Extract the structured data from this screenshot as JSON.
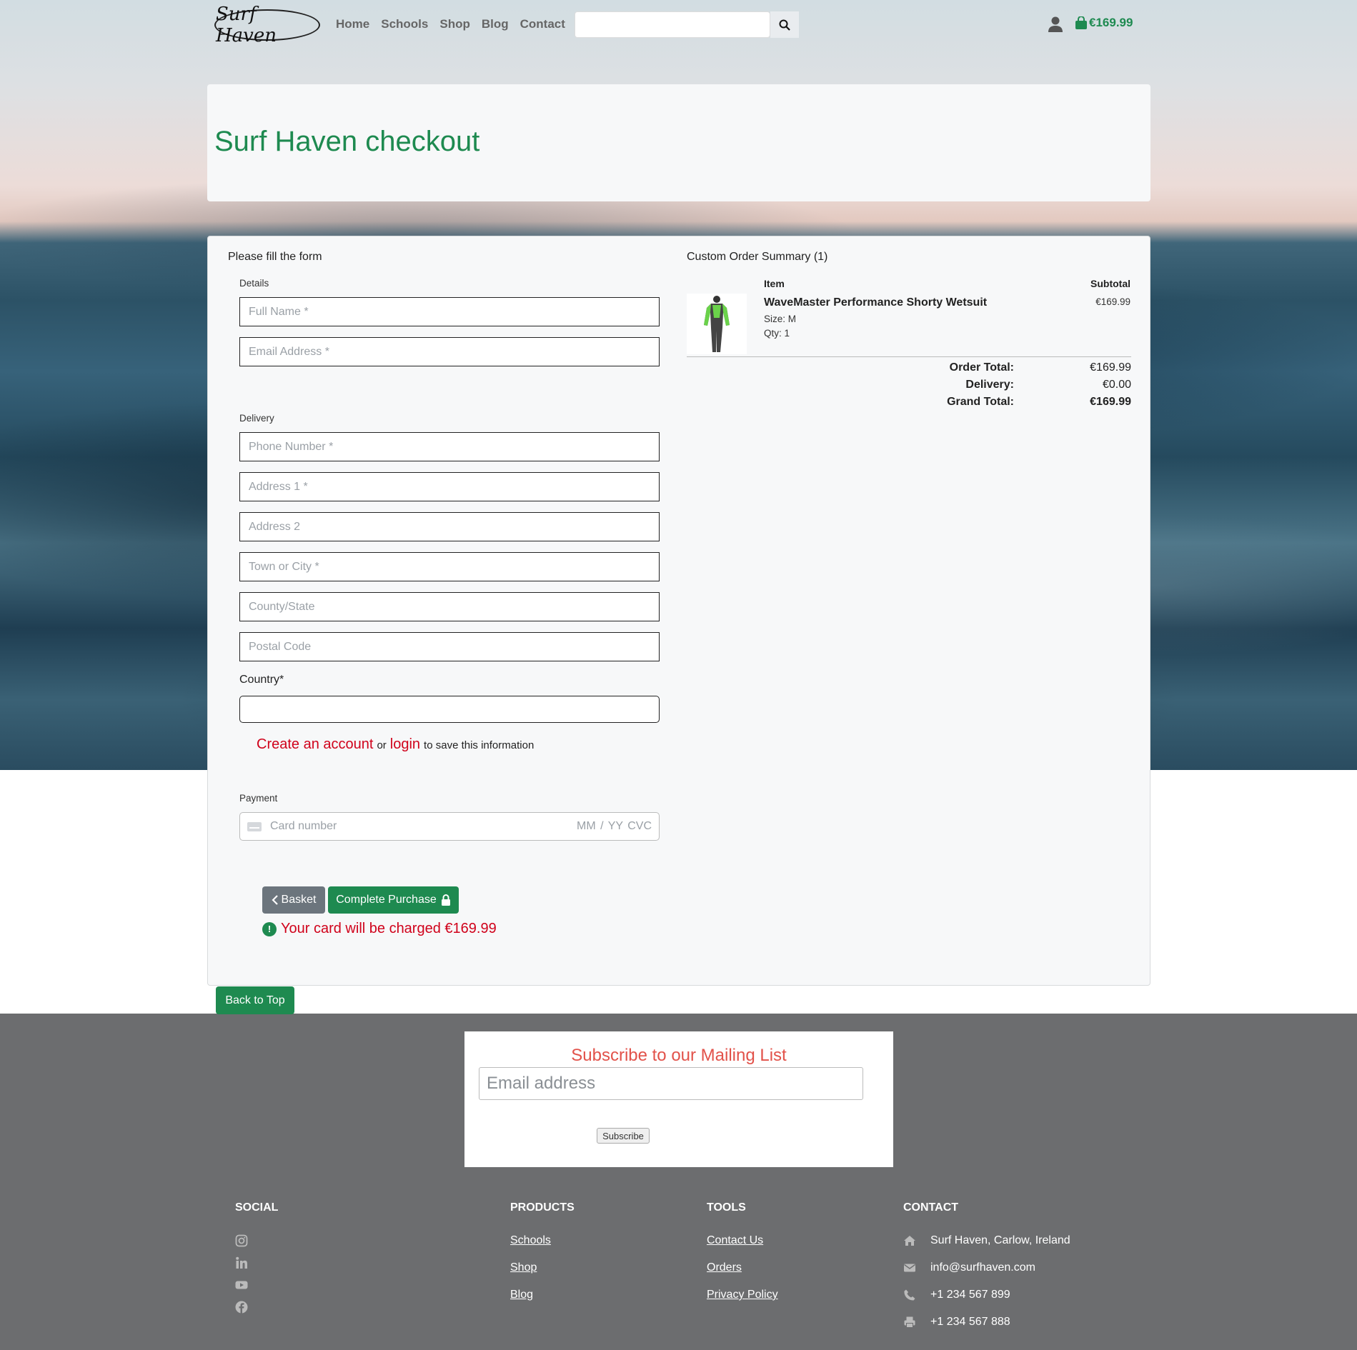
{
  "nav": {
    "logo_text": "Surf Haven",
    "links": [
      "Home",
      "Schools",
      "Shop",
      "Blog",
      "Contact"
    ],
    "cart_total": "€169.99"
  },
  "header": {
    "title": "Surf Haven checkout"
  },
  "form": {
    "heading": "Please fill the form",
    "details_label": "Details",
    "full_name_placeholder": "Full Name *",
    "email_placeholder": "Email Address *",
    "delivery_label": "Delivery",
    "phone_placeholder": "Phone Number *",
    "address1_placeholder": "Address 1 *",
    "address2_placeholder": "Address 2",
    "town_placeholder": "Town or City *",
    "county_placeholder": "County/State",
    "postcode_placeholder": "Postal Code",
    "country_label": "Country*",
    "create_account": "Create an account",
    "or": "or",
    "login": "login",
    "save_info": "to save this information",
    "payment_label": "Payment",
    "card_number_placeholder": "Card number",
    "card_extra": "MM / YY  CVC"
  },
  "buttons": {
    "basket": "Basket",
    "complete": "Complete Purchase"
  },
  "charge_notice": "Your card will be charged €169.99",
  "summary": {
    "heading": "Custom Order Summary (1)",
    "col_item": "Item",
    "col_subtotal": "Subtotal",
    "product": {
      "name": "WaveMaster Performance Shorty Wetsuit",
      "size": "Size: M",
      "qty": "Qty: 1",
      "price": "€169.99"
    },
    "order_total_label": "Order Total:",
    "order_total": "€169.99",
    "delivery_label": "Delivery:",
    "delivery": "€0.00",
    "grand_total_label": "Grand Total:",
    "grand_total": "€169.99"
  },
  "back_to_top": "Back to Top",
  "subscribe": {
    "title": "Subscribe to our Mailing List",
    "placeholder": "Email address",
    "button": "Subscribe"
  },
  "footer": {
    "social_heading": "SOCIAL",
    "social_icons": [
      "instagram-icon",
      "linkedin-icon",
      "youtube-icon",
      "facebook-icon"
    ],
    "products_heading": "PRODUCTS",
    "products_links": [
      "Schools",
      "Shop",
      "Blog"
    ],
    "tools_heading": "TOOLS",
    "tools_links": [
      "Contact Us",
      "Orders",
      "Privacy Policy"
    ],
    "contact_heading": "CONTACT",
    "address": "Surf Haven, Carlow, Ireland",
    "email": "info@surfhaven.com",
    "phone": "+1 234 567 899",
    "fax": "+1 234 567 888"
  },
  "colors": {
    "brand_green": "#1e8a50",
    "alert_red": "#d0021b",
    "subscribe_red": "#e2524a",
    "footer_gray": "#6c6d6f"
  }
}
